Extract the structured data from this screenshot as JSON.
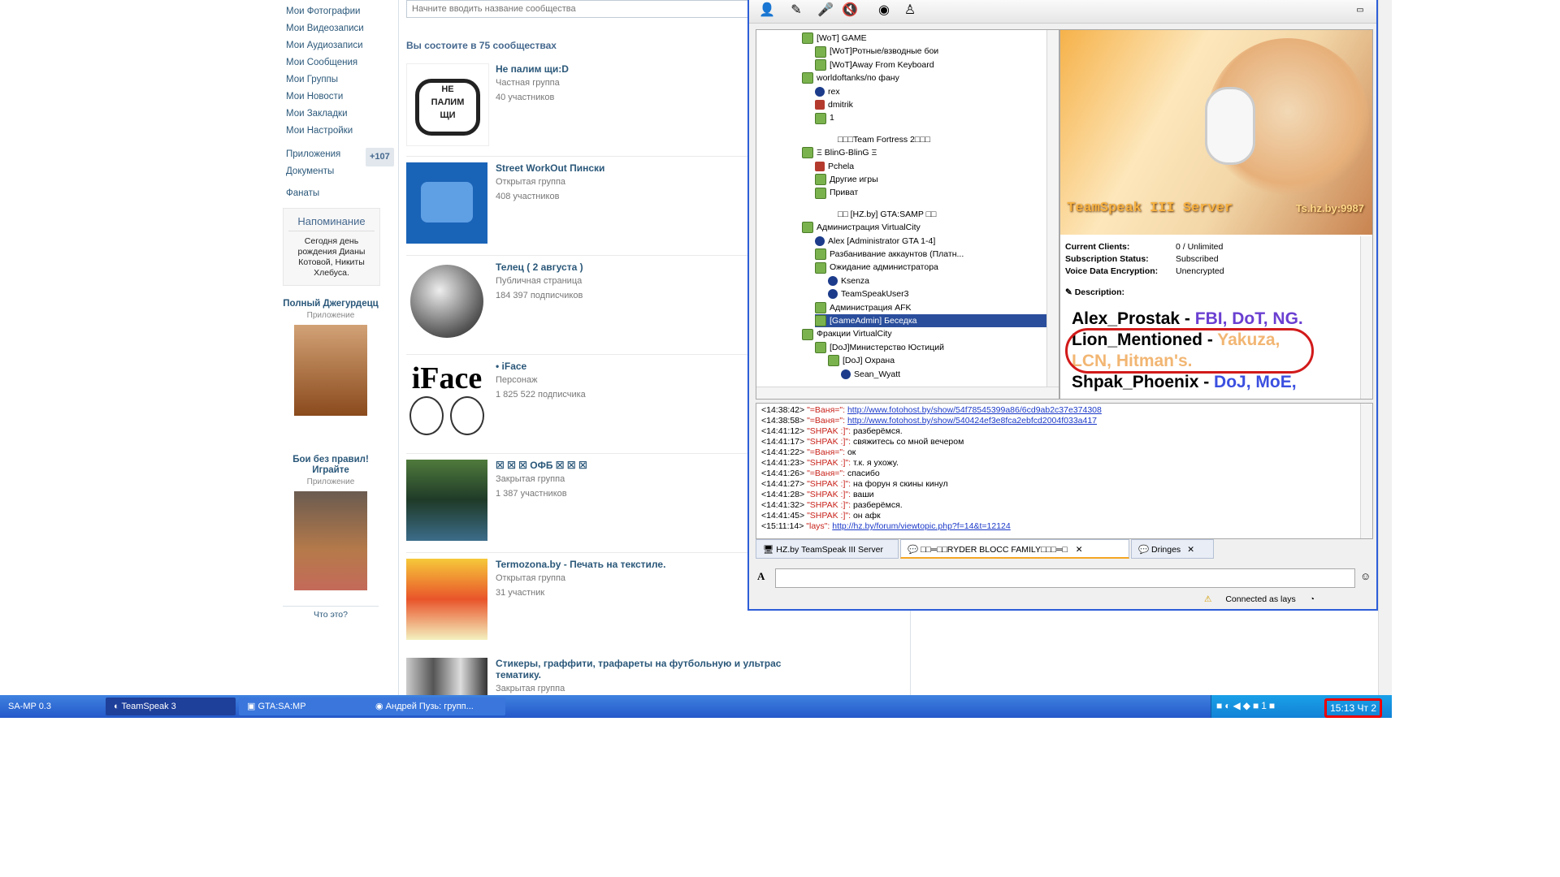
{
  "vk": {
    "sidebar_items": [
      "Мои Фотографии",
      "Мои Видеозаписи",
      "Мои Аудиозаписи",
      "Мои Сообщения",
      "Мои Группы",
      "Мои Новости",
      "Мои Закладки",
      "Мои Настройки"
    ],
    "apps_label": "Приложения",
    "apps_badge": "+107",
    "docs_label": "Документы",
    "fans_label": "Фанаты",
    "reminder_title": "Напоминание",
    "reminder_body": "Сегодня день рождения Дианы Котовой, Никиты Хлебуса.",
    "app1_title": "Полный Джегурдецц",
    "app1_sub": "Приложение",
    "app2_title": "Бои без правил! Играйте",
    "app2_sub": "Приложение",
    "what_label": "Что это?",
    "search_placeholder": "Начните вводить название сообщества",
    "communities_head": "Вы состоите в 75 сообществах",
    "communities": [
      {
        "name": "Не палим щи:D",
        "type": "Частная группа",
        "count": "40 участников"
      },
      {
        "name": "Street WorkOut Пински",
        "type": "Открытая группа",
        "count": "408 участников"
      },
      {
        "name": "Телец ( 2 августа )",
        "type": "Публичная страница",
        "count": "184 397 подписчиков"
      },
      {
        "name": "• iFace",
        "type": "Персонаж",
        "count": "1 825 522 подписчика"
      },
      {
        "name": "☒ ☒ ☒ ОФБ ☒ ☒ ☒",
        "type": "Закрытая группа",
        "count": "1 387 участников"
      },
      {
        "name": "Termozona.by - Печать на текстиле.",
        "type": "Открытая группа",
        "count": "31 участник"
      },
      {
        "name": "Стикеры, граффити, трафареты на футбольную и ультрас тематику.",
        "type": "Закрытая группа",
        "count": ""
      }
    ]
  },
  "ts": {
    "tree": [
      {
        "label": "[WoT] GAME",
        "kind": "ch",
        "indent": 1
      },
      {
        "label": "[WoT]Ротные/взводные бои",
        "kind": "ch",
        "indent": 2
      },
      {
        "label": "[WoT]Away From Keyboard",
        "kind": "ch",
        "indent": 2
      },
      {
        "label": "worldoftanks/по фану",
        "kind": "ch",
        "indent": 1
      },
      {
        "label": "rex",
        "kind": "user",
        "indent": 2
      },
      {
        "label": "dmitrik",
        "kind": "mute",
        "indent": 2
      },
      {
        "label": "1",
        "kind": "ch",
        "indent": 2
      },
      {
        "label": "",
        "kind": "space",
        "indent": 0
      },
      {
        "label": "□□□Team Fortress 2□□□",
        "kind": "spacer",
        "indent": 0
      },
      {
        "label": "Ξ BlinG-BlinG Ξ",
        "kind": "ch",
        "indent": 1
      },
      {
        "label": "Pchela",
        "kind": "mute",
        "indent": 2
      },
      {
        "label": "Другие игры",
        "kind": "ch",
        "indent": 2
      },
      {
        "label": "Приват",
        "kind": "ch",
        "indent": 2
      },
      {
        "label": "",
        "kind": "space",
        "indent": 0
      },
      {
        "label": "□□ [HZ.by] GTA:SAMP □□",
        "kind": "spacer",
        "indent": 0
      },
      {
        "label": "Администрация VirtualCity",
        "kind": "ch",
        "indent": 1
      },
      {
        "label": "Alex [Administrator GTA 1-4]",
        "kind": "user",
        "indent": 2
      },
      {
        "label": "Разбанивание аккаунтов (Платн...",
        "kind": "ch",
        "indent": 2
      },
      {
        "label": "Ожидание администратора",
        "kind": "ch",
        "indent": 2
      },
      {
        "label": "Ksenza",
        "kind": "user",
        "indent": 3
      },
      {
        "label": "TeamSpeakUser3",
        "kind": "user",
        "indent": 3
      },
      {
        "label": "Администрация AFK",
        "kind": "ch",
        "indent": 2
      },
      {
        "label": "[GameAdmin] Беседка",
        "kind": "ch",
        "indent": 2,
        "selected": true
      },
      {
        "label": "Фракции VirtualCity",
        "kind": "ch",
        "indent": 1
      },
      {
        "label": "[DoJ]Министерство Юстиций",
        "kind": "ch",
        "indent": 2
      },
      {
        "label": "[DoJ] Охрана",
        "kind": "ch",
        "indent": 3
      },
      {
        "label": "Sean_Wyatt",
        "kind": "user",
        "indent": 4
      }
    ],
    "banner_title": "TeamSpeak III Server",
    "banner_sub": "Ts.hz.by:9987",
    "info": [
      {
        "k": "Current Clients:",
        "v": "0 / Unlimited"
      },
      {
        "k": "Subscription Status:",
        "v": "Subscribed"
      },
      {
        "k": "Voice Data Encryption:",
        "v": "Unencrypted"
      }
    ],
    "description_label": "Description:",
    "desc_lines": [
      {
        "name": "Alex_Prostak - ",
        "factions": "FBI, DoT, NG.",
        "color": "#6a3fd1"
      },
      {
        "name": "Lion_Mentioned - ",
        "factions": "Yakuza,",
        "color": "#f2b673"
      },
      {
        "name": "",
        "factions": "LCN, Hitman's.",
        "color": "#f2b673"
      },
      {
        "name": "Shpak_Phoenix - ",
        "factions": "DoJ, MoE,",
        "color": "#3b4fe0"
      }
    ],
    "chat": [
      {
        "time": "<14:38:42>",
        "nick": "\"=Ваня=\":",
        "text": "",
        "link": "http://www.fotohost.by/show/54f78545399a86/6cd9ab2c37e374308"
      },
      {
        "time": "<14:38:58>",
        "nick": "\"=Ваня=\":",
        "text": "",
        "link": "http://www.fotohost.by/show/540424ef3e8fca2ebfcd2004f033a417"
      },
      {
        "time": "<14:41:12>",
        "nick": "\"SHPAK :]\":",
        "text": "разберёмся.",
        "link": ""
      },
      {
        "time": "<14:41:17>",
        "nick": "\"SHPAK :]\":",
        "text": "свяжитесь со мной вечером",
        "link": ""
      },
      {
        "time": "<14:41:22>",
        "nick": "\"=Ваня=\":",
        "text": "ок",
        "link": ""
      },
      {
        "time": "<14:41:23>",
        "nick": "\"SHPAK :]\":",
        "text": "т.к. я ухожу.",
        "link": ""
      },
      {
        "time": "<14:41:26>",
        "nick": "\"=Ваня=\":",
        "text": "спасибо",
        "link": ""
      },
      {
        "time": "<14:41:27>",
        "nick": "\"SHPAK :]\":",
        "text": "на форун я скины кинул",
        "link": ""
      },
      {
        "time": "<14:41:28>",
        "nick": "\"SHPAK :]\":",
        "text": "ваши",
        "link": ""
      },
      {
        "time": "<14:41:32>",
        "nick": "\"SHPAK :]\":",
        "text": "разберёмся.",
        "link": ""
      },
      {
        "time": "<14:41:45>",
        "nick": "\"SHPAK :]\":",
        "text": "он афк",
        "link": ""
      },
      {
        "time": "<15:11:14>",
        "nick": "\"lays\":",
        "text": "",
        "link": "http://hz.by/forum/viewtopic.php?f=14&t=12124"
      }
    ],
    "tabs": [
      "HZ.by TeamSpeak III Server",
      "□□═□□RYDER BLOCC FAMILY□□□═□",
      "Dringes"
    ],
    "status": "Connected as lays"
  },
  "taskbar": {
    "items": [
      "SA-MP 0.3",
      "TeamSpeak 3",
      "GTA:SA:MP",
      "Андрей Пузь: групп..."
    ],
    "clock": "15:13 Чт 2"
  }
}
